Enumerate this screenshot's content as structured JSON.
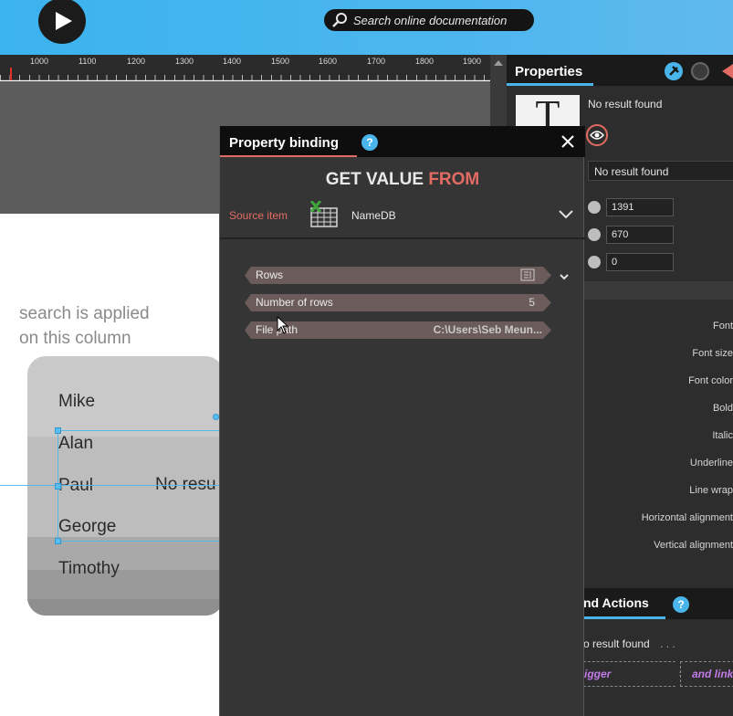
{
  "topbar": {
    "search_placeholder": "Search online documentation"
  },
  "ruler": {
    "labels": [
      "1000",
      "1100",
      "1200",
      "1300",
      "1400",
      "1500",
      "1600",
      "1700",
      "1800",
      "1900"
    ]
  },
  "canvas": {
    "hint_line1": "search is applied",
    "hint_line2": "on this column",
    "names": [
      "Mike",
      "Alan",
      "Paul",
      "George",
      "Timothy"
    ],
    "partial_text": "No resu"
  },
  "properties": {
    "title": "Properties",
    "preview_glyph": "T",
    "no_result_1": "No result found",
    "no_result_2": "No result found",
    "values": [
      "1391",
      "670",
      "0"
    ],
    "labels": [
      "Font",
      "Font size",
      "Font color",
      "Bold",
      "Italic",
      "Underline",
      "Line wrap",
      "Horizontal alignment",
      "Vertical alignment"
    ],
    "actions_title": "nd Actions",
    "actions_no_result": "o result found",
    "actions_dots": ". . .",
    "chip1": "igger",
    "chip2": "and link",
    "colors": {
      "accent": "#49b5ea",
      "alert": "#e26b63",
      "trigger_text": "#c27be6"
    }
  },
  "dialog": {
    "title": "Property binding",
    "help": "?",
    "heading_part1": "GET VALUE",
    "heading_part2": "FROM",
    "source_label": "Source item",
    "source_name": "NameDB",
    "rows": [
      {
        "label": "Rows",
        "value": ""
      },
      {
        "label": "Number of rows",
        "value": "5"
      },
      {
        "label": "File path",
        "value": "C:\\Users\\Seb Meun..."
      }
    ]
  },
  "icons": {
    "play": "play-icon",
    "search": "search-icon",
    "close": "close-icon",
    "help": "help-icon",
    "excel": "excel-table-icon",
    "chevron": "chevron-down-icon",
    "eye": "eye-icon",
    "list": "list-icon"
  }
}
